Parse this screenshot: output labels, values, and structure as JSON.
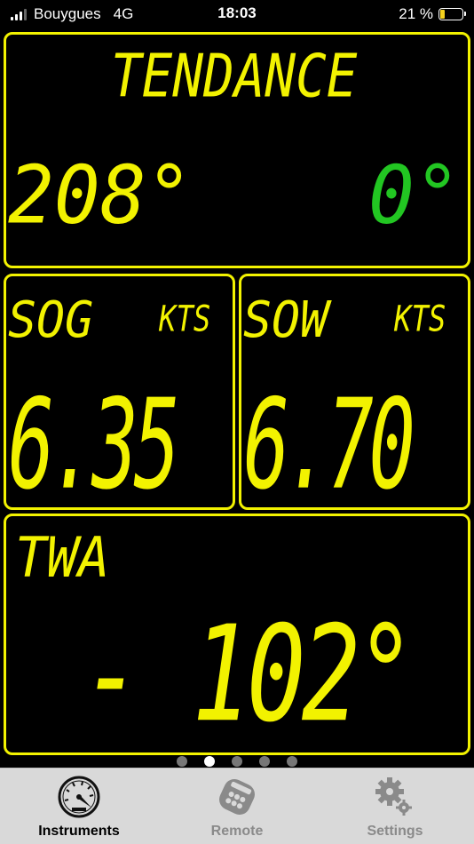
{
  "status_bar": {
    "carrier": "Bouygues",
    "network": "4G",
    "time": "18:03",
    "battery_percent": "21 %",
    "battery_level": 0.21
  },
  "panels": {
    "tendance": {
      "title": "TENDANCE",
      "heading_value": "208°",
      "trend_value": "0°"
    },
    "sog": {
      "label": "SOG",
      "unit": "KTS",
      "value": "6.35"
    },
    "sow": {
      "label": "SOW",
      "unit": "KTS",
      "value": "6.70"
    },
    "twa": {
      "label": "TWA",
      "value": "- 102°"
    }
  },
  "pager": {
    "count": 5,
    "active_index": 1
  },
  "tabs": [
    {
      "label": "Instruments",
      "icon": "gauge-icon",
      "active": true
    },
    {
      "label": "Remote",
      "icon": "remote-icon",
      "active": false
    },
    {
      "label": "Settings",
      "icon": "gears-icon",
      "active": false
    }
  ],
  "colors": {
    "segment_yellow": "#f2f200",
    "segment_green": "#22c622",
    "background": "#000000",
    "tab_bar": "#d9d9d9"
  }
}
